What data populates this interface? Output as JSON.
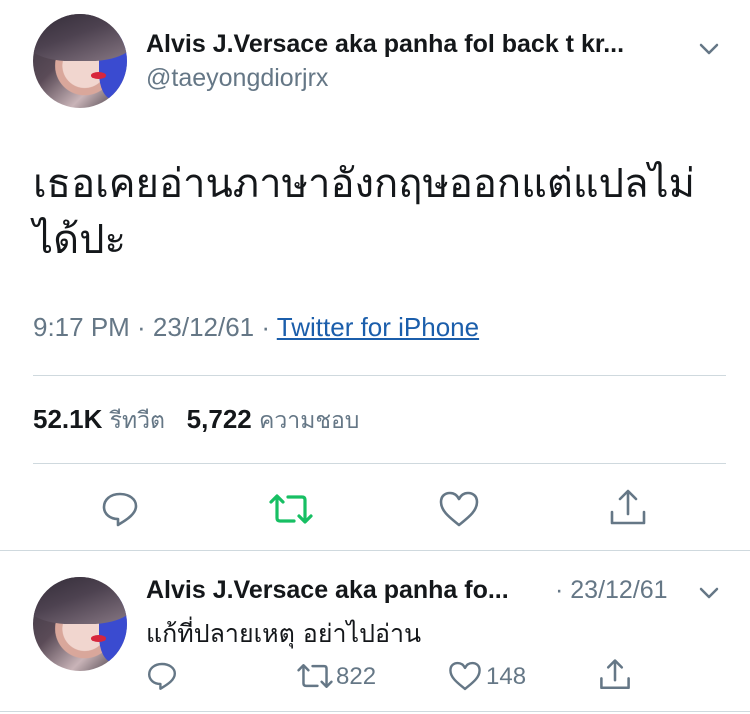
{
  "tweet": {
    "author_name": "Alvis J.Versace aka panha fol back t kr...",
    "handle": "@taeyongdiorjrx",
    "text": "เธอเคยอ่านภาษาอังกฤษออกแต่แปลไม่ได้ปะ",
    "time": "9:17 PM · 23/12/61 · ",
    "source": "Twitter for iPhone",
    "retweet_count": "52.1K",
    "retweet_label": "รีทวีต",
    "like_count": "5,722",
    "like_label": "ความชอบ"
  },
  "reply": {
    "author_name": "Alvis J.Versace aka panha fo...",
    "date": "· 23/12/61",
    "text": "แก้ที่ปลายเหตุ อย่าไปอ่าน",
    "retweet_count": "822",
    "like_count": "148"
  },
  "icons": {
    "reply": "comment-bubble-icon",
    "retweet": "retweet-icon",
    "like": "heart-icon",
    "share": "share-icon",
    "more": "chevron-down-icon"
  },
  "colors": {
    "retweet_active": "#17bf63",
    "link": "#1b5eab",
    "secondary_text": "#657786"
  }
}
